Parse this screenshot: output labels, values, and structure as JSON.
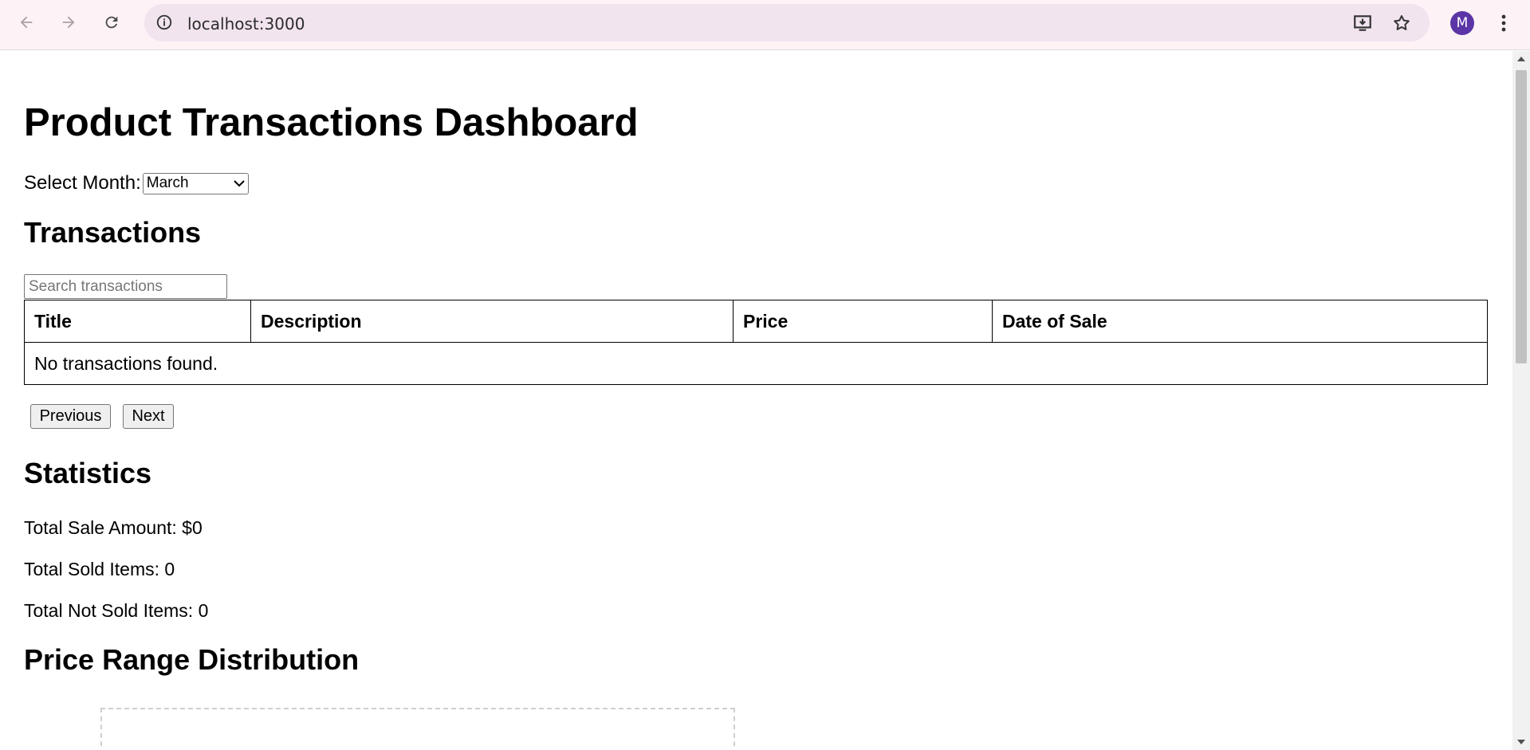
{
  "browser": {
    "url": "localhost:3000",
    "profile_initial": "M",
    "icons": [
      "back-arrow-icon",
      "forward-arrow-icon",
      "reload-icon",
      "site-info-icon",
      "install-app-icon",
      "bookmark-star-icon",
      "kebab-menu-icon"
    ]
  },
  "page": {
    "title": "Product Transactions Dashboard",
    "month_label": "Select Month:",
    "month_selected": "March",
    "transactions_heading": "Transactions",
    "search_placeholder": "Search transactions",
    "table": {
      "columns": [
        "Title",
        "Description",
        "Price",
        "Date of Sale"
      ],
      "empty_message": "No transactions found."
    },
    "pagination": {
      "previous": "Previous",
      "next": "Next"
    },
    "statistics_heading": "Statistics",
    "stats": {
      "total_sale_amount": "Total Sale Amount: $0",
      "total_sold_items": "Total Sold Items: 0",
      "total_not_sold_items": "Total Not Sold Items: 0"
    },
    "price_range_heading": "Price Range Distribution"
  },
  "colors": {
    "chrome_bg": "#fdf3f6",
    "omnibox_bg": "#f1e4ef",
    "avatar_bg": "#5b35a6"
  }
}
